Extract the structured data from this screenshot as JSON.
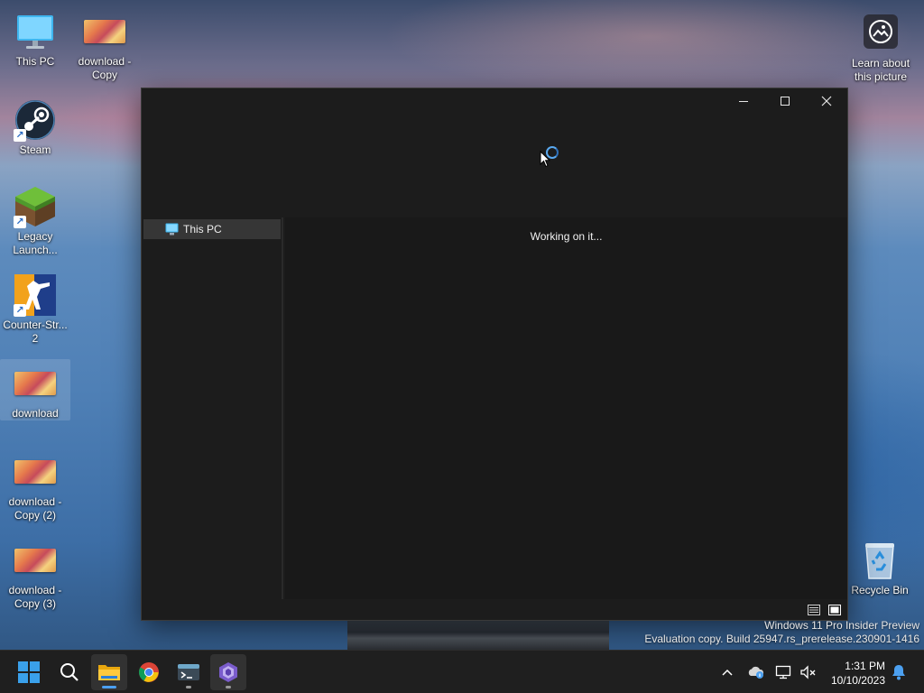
{
  "desktop": {
    "icons": [
      {
        "label": "This PC"
      },
      {
        "label": "download - Copy"
      },
      {
        "label": "Steam"
      },
      {
        "label": "Legacy Launch..."
      },
      {
        "label": "Counter-Str... 2"
      },
      {
        "label": "download"
      },
      {
        "label": "download - Copy (2)"
      },
      {
        "label": "download - Copy (3)"
      },
      {
        "label": "Recycle Bin"
      },
      {
        "label": "Learn about this picture"
      }
    ]
  },
  "explorer": {
    "nav": {
      "selected_item": "This PC"
    },
    "content": {
      "status_message": "Working on it..."
    },
    "accent_color": "#4ca0f0"
  },
  "watermark": {
    "line1": "Windows 11 Pro Insider Preview",
    "line2": "Evaluation copy. Build 25947.rs_prerelease.230901-1416"
  },
  "taskbar": {
    "items": [
      "windows-start-icon",
      "search-icon",
      "file-explorer-icon",
      "chrome-icon",
      "terminal-icon",
      "visual-studio-icon"
    ],
    "tray": {
      "time": "1:31 PM",
      "date": "10/10/2023"
    }
  }
}
